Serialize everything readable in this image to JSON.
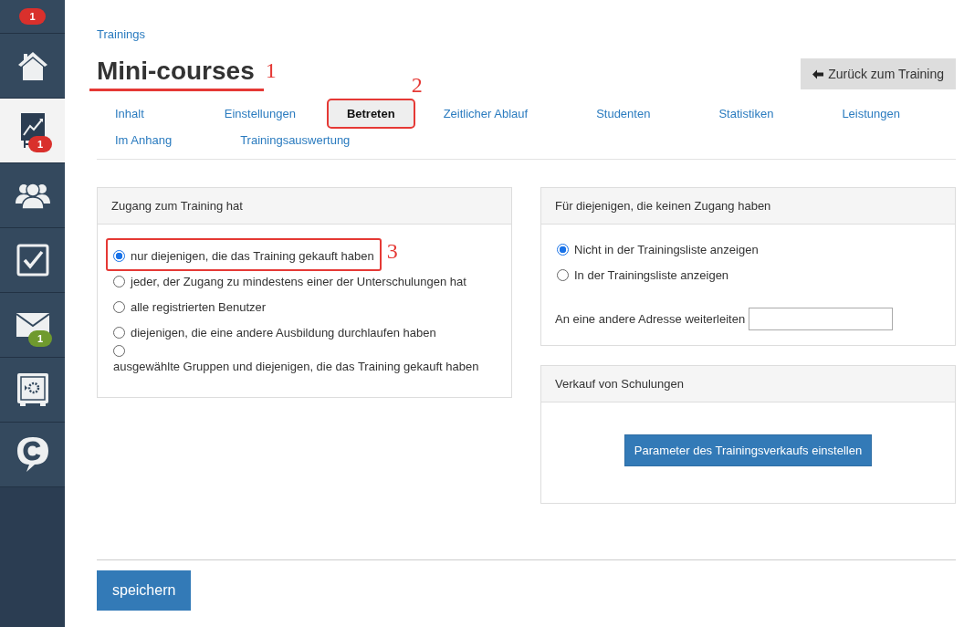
{
  "sidebar": {
    "top_badge": "1",
    "items": [
      {
        "kind": "home",
        "selected": false
      },
      {
        "kind": "chart",
        "selected": true,
        "badge": "1",
        "color": "#d9302c"
      },
      {
        "kind": "people",
        "selected": false
      },
      {
        "kind": "check",
        "selected": false
      },
      {
        "kind": "mail",
        "selected": false,
        "badge": "1",
        "color": "#6f9a2e"
      },
      {
        "kind": "safe",
        "selected": false
      },
      {
        "kind": "logo",
        "selected": false
      }
    ]
  },
  "breadcrumb": "Trainings",
  "title": {
    "text": "Mini-courses",
    "annotation": "1"
  },
  "back_button": "Zurück zum Training",
  "tabs": [
    {
      "label": "Inhalt",
      "selected": false
    },
    {
      "label": "Einstellungen",
      "selected": false
    },
    {
      "label": "Betreten",
      "selected": true,
      "annotation": "2"
    },
    {
      "label": "Zeitlicher Ablauf",
      "selected": false
    },
    {
      "label": "Studenten",
      "selected": false
    },
    {
      "label": "Statistiken",
      "selected": false
    },
    {
      "label": "Leistungen",
      "selected": false
    },
    {
      "label": "Im Anhang",
      "selected": false
    },
    {
      "label": "Trainingsauswertung",
      "selected": false
    }
  ],
  "access_panel": {
    "title": "Zugang zum Training hat",
    "options": [
      {
        "label": "nur diejenigen, die das Training gekauft haben",
        "selected": true,
        "annotation": "3"
      },
      {
        "label": "jeder, der Zugang zu mindestens einer der Unterschulungen hat",
        "selected": false
      },
      {
        "label": "alle registrierten Benutzer",
        "selected": false
      },
      {
        "label": "diejenigen, die eine andere Ausbildung durchlaufen haben",
        "selected": false
      },
      {
        "label": "ausgewählte Gruppen und diejenigen, die das Training gekauft haben",
        "selected": false
      }
    ]
  },
  "no_access_panel": {
    "title": "Für diejenigen, die keinen Zugang haben",
    "options": [
      {
        "label": "Nicht in der Trainingsliste anzeigen",
        "selected": true
      },
      {
        "label": "In der Trainingsliste anzeigen",
        "selected": false
      }
    ],
    "redirect_label": "An eine andere Adresse weiterleiten"
  },
  "sales_panel": {
    "title": "Verkauf von Schulungen",
    "button": "Parameter des Trainingsverkaufs einstellen"
  },
  "save_button": "speichern"
}
